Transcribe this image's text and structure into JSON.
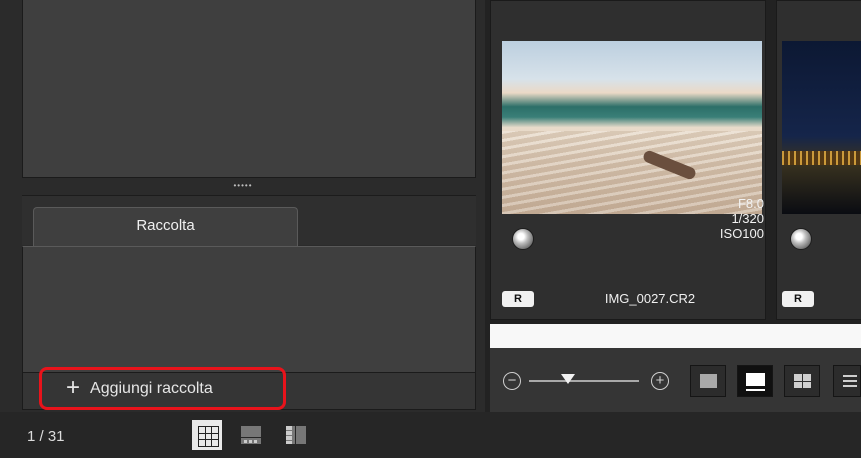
{
  "collection_panel": {
    "tab_label": "Raccolta",
    "add_button_label": "Aggiungi raccolta",
    "add_icon": "plus-icon",
    "highlight_color": "#e8131b"
  },
  "status_bar": {
    "page_counter": "1 / 31",
    "view_buttons": [
      "grid-view-icon",
      "filmstrip-view-icon",
      "split-view-icon"
    ]
  },
  "thumbnails": [
    {
      "filename": "IMG_0027.CR2",
      "aperture": "F8.0",
      "shutter": "1/320",
      "iso": "ISO100",
      "badge": "R"
    },
    {
      "filename": "",
      "badge": "R"
    }
  ],
  "zoom": {
    "out_icon": "zoom-out-icon",
    "in_icon": "zoom-in-icon",
    "level_fraction": 0.35
  },
  "layout_buttons": [
    "single-thumbnail-icon",
    "large-thumbnail-icon",
    "grid-thumbnail-icon",
    "list-icon"
  ]
}
